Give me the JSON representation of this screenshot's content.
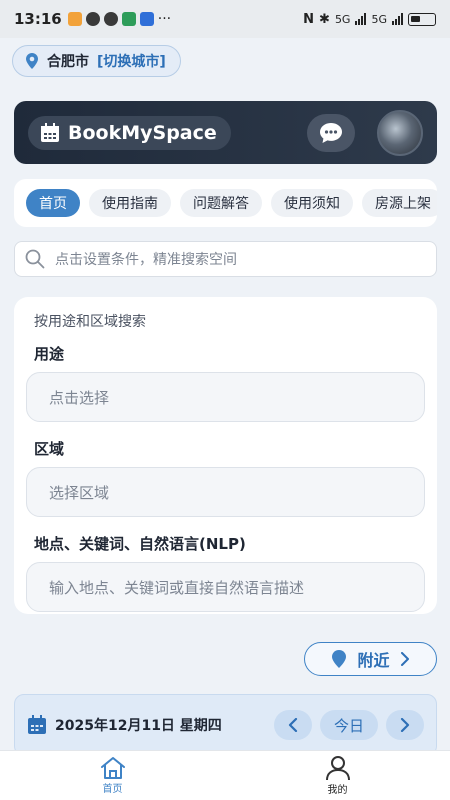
{
  "status_bar": {
    "time": "13:16",
    "extra_icons": "···",
    "network_1": "5G",
    "network_2": "5G"
  },
  "location": {
    "city": "合肥市",
    "switch_label": "[切换城市]",
    "icon": "location-pin-icon"
  },
  "header": {
    "brand": "BookMySpace",
    "brand_icon": "calendar-icon",
    "chat_icon": "chat-bubble-icon",
    "avatar": "user-avatar"
  },
  "tabs": [
    {
      "label": "首页",
      "active": true
    },
    {
      "label": "使用指南",
      "active": false
    },
    {
      "label": "问题解答",
      "active": false
    },
    {
      "label": "使用须知",
      "active": false
    },
    {
      "label": "房源上架",
      "active": false
    }
  ],
  "search": {
    "placeholder": "点击设置条件，精准搜索空间"
  },
  "filter": {
    "title": "按用途和区域搜索",
    "usage_label": "用途",
    "usage_placeholder": "点击选择",
    "area_label": "区域",
    "area_placeholder": "选择区域",
    "keyword_label": "地点、关键词、自然语言(NLP)",
    "keyword_placeholder": "输入地点、关键词或直接自然语言描述"
  },
  "nearby": {
    "label": "附近"
  },
  "date_bar": {
    "date": "2025年12月11日 星期四",
    "today_label": "今日"
  },
  "bottom_nav": {
    "home": "首页",
    "mine": "我的"
  },
  "colors": {
    "accent": "#3f83c6",
    "header_bg": "#1f2a3a",
    "page_bg": "#eef2f7"
  }
}
